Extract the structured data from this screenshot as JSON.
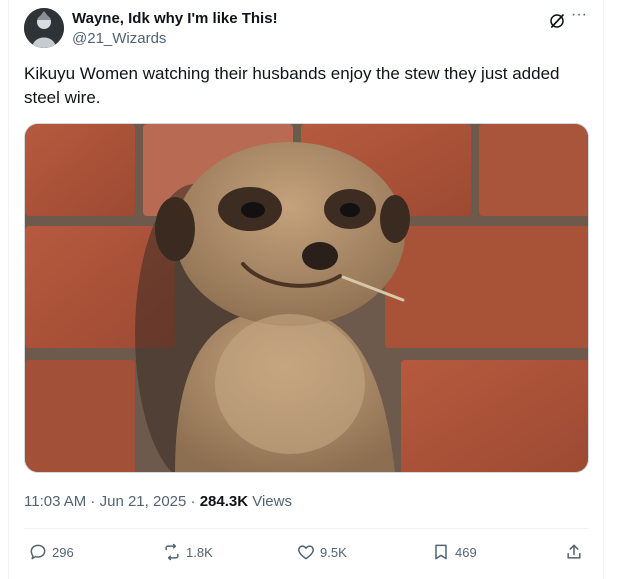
{
  "tweet": {
    "display_name": "Wayne, Idk why I'm like This!",
    "handle": "@21_Wizards",
    "text": "Kikuyu Women watching their husbands enjoy the stew they just added steel wire.",
    "time": "11:03 AM",
    "sep1": " · ",
    "date": "Jun 21, 2025",
    "sep2": " · ",
    "views_count": "284.3K",
    "views_label": " Views"
  },
  "actions": {
    "replies": "296",
    "reposts": "1.8K",
    "likes": "9.5K",
    "bookmarks": "469"
  },
  "icons": {
    "more": "more-dots-icon",
    "grok": "grok-icon",
    "reply": "reply-icon",
    "repost": "repost-icon",
    "like": "heart-icon",
    "bookmark": "bookmark-icon",
    "share": "share-icon"
  },
  "colors": {
    "text": "#0f1419",
    "secondary": "#536471",
    "border": "#eff3f4"
  }
}
